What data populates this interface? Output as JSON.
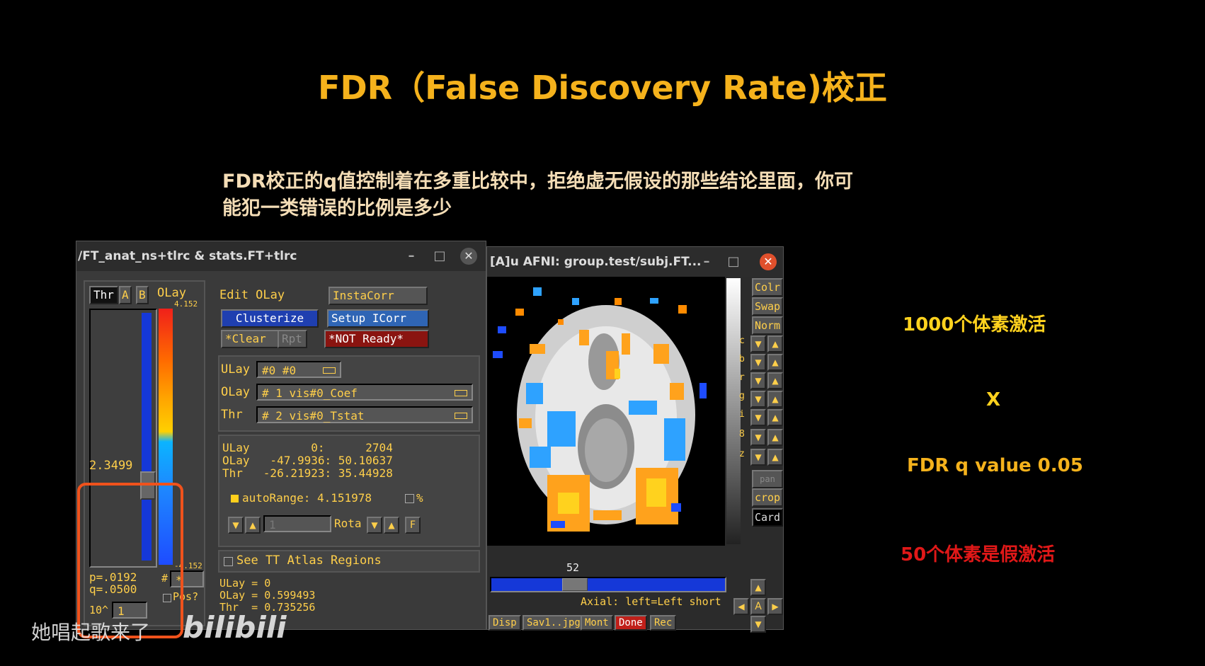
{
  "slide": {
    "title": "FDR（False Discovery Rate)校正",
    "description_line1": "FDR校正的q值控制着在多重比较中，拒绝虚无假设的那些结论里面，你可",
    "description_line2": "能犯一类错误的比例是多少",
    "side_text": {
      "voxels": "1000个体素激活",
      "times": "X",
      "fdr": "FDR q value 0.05",
      "false_active": "50个体素是假激活"
    },
    "colors": {
      "title": "#f5b21c",
      "voxels": "#ffd21e",
      "false_active": "#e01818",
      "highlight_box": "#f0521c"
    }
  },
  "left_window": {
    "title": "/FT_anat_ns+tlrc & stats.FT+tlrc",
    "controls": {
      "minimize": "–",
      "maximize": "□",
      "close": "✕"
    },
    "tabs": {
      "thr": "Thr",
      "a": "A",
      "b": "B",
      "olay": "OLay"
    },
    "colorbar": {
      "max": "4.152",
      "min": "-4.152"
    },
    "threshold_value": "2.3499",
    "p_value": "p=.0192",
    "q_value": "q=.0500",
    "exponent_label": "10^",
    "exponent_value": "1",
    "hash": "#",
    "star": "*",
    "pos_label": "Pos?",
    "edit_olay": "Edit OLay",
    "instacorr": "InstaCorr",
    "clusterize": "Clusterize",
    "setup_icorr": "Setup ICorr",
    "clear": "*Clear",
    "rpt": "Rpt",
    "not_ready": "*NOT Ready*",
    "ulay_label": "ULay",
    "ulay_value": "#0 #0",
    "olay_label": "OLay",
    "olay_value": "# 1 vis#0_Coef",
    "thr_label": "Thr",
    "thr_value": "# 2 vis#0_Tstat",
    "info_ulay": "ULay         0:      2704",
    "info_olay": "OLay   -47.9936: 50.10637",
    "info_thr": "Thr   -26.21923: 35.44928",
    "autorange": "autoRange: 4.151978",
    "percent": "%",
    "rota_input": "1",
    "rota_label": "Rota",
    "f_label": "F",
    "see_tt": "See TT Atlas Regions",
    "val_ulay": "ULay = 0",
    "val_olay": "OLay = 0.599493",
    "val_thr": "Thr  = 0.735256"
  },
  "right_window": {
    "title": "[A]u AFNI: group.test/subj.FT...",
    "controls": {
      "minimize": "–",
      "maximize": "□",
      "close": "✕"
    },
    "slice_number": "52",
    "orientation": "Axial: left=Left short",
    "side_buttons": [
      "Colr",
      "Swap",
      "Norm"
    ],
    "side_letters": [
      "c",
      "b",
      "r",
      "g",
      "i",
      "8",
      "z"
    ],
    "pan": "pan",
    "crop": "crop",
    "card": "Card",
    "small_a": "A",
    "bottom_buttons": [
      "Disp",
      "Sav1..jpg",
      "Mont",
      "Done",
      "Rec"
    ]
  },
  "watermark": {
    "text": "她唱起歌来了",
    "logo": "bilibili"
  }
}
